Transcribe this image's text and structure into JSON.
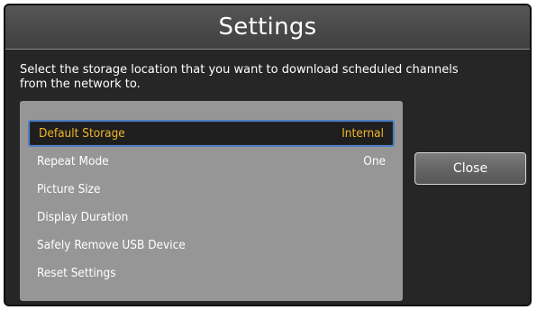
{
  "dialog": {
    "title": "Settings",
    "description_lines": [
      "Select the storage location that you want to download scheduled channels",
      "from the network to."
    ]
  },
  "menu": {
    "items": [
      {
        "label": "Default Storage",
        "value": "Internal",
        "selected": true
      },
      {
        "label": "Repeat Mode",
        "value": "One",
        "selected": false
      },
      {
        "label": "Picture Size",
        "value": "",
        "selected": false
      },
      {
        "label": "Display Duration",
        "value": "",
        "selected": false
      },
      {
        "label": "Safely Remove USB Device",
        "value": "",
        "selected": false
      },
      {
        "label": "Reset Settings",
        "value": "",
        "selected": false
      }
    ]
  },
  "buttons": {
    "close_label": "Close"
  },
  "colors": {
    "selected_text": "#f2b626",
    "focus_border": "#4a7ec4",
    "panel": "#969696",
    "background": "#262626"
  }
}
